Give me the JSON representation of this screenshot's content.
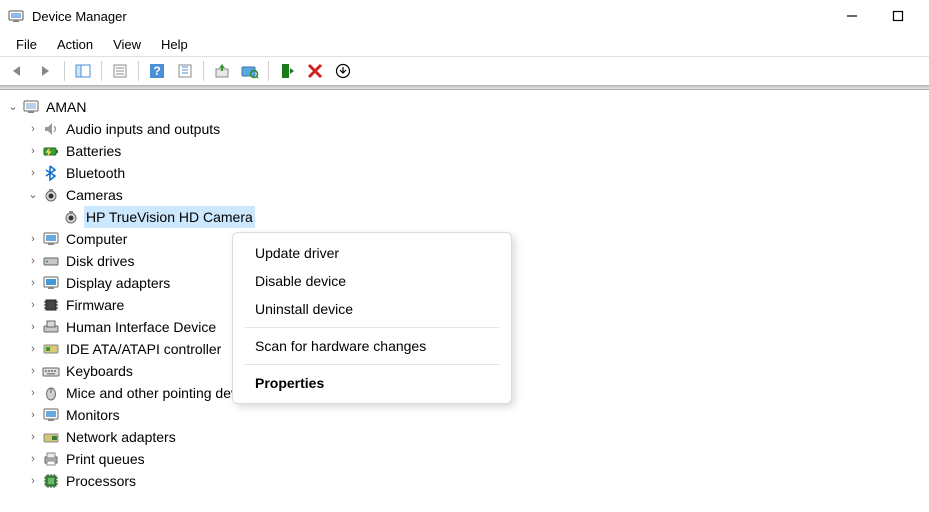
{
  "window": {
    "title": "Device Manager"
  },
  "menu": {
    "file": "File",
    "action": "Action",
    "view": "View",
    "help": "Help"
  },
  "tree": {
    "root": "AMAN",
    "audio": "Audio inputs and outputs",
    "batteries": "Batteries",
    "bluetooth": "Bluetooth",
    "cameras": "Cameras",
    "camera_device": "HP TrueVision HD Camera",
    "computer": "Computer",
    "disk": "Disk drives",
    "display": "Display adapters",
    "firmware": "Firmware",
    "hid": "Human Interface Device",
    "ide": "IDE ATA/ATAPI controller",
    "keyboards": "Keyboards",
    "mice": "Mice and other pointing devices",
    "monitors": "Monitors",
    "network": "Network adapters",
    "print": "Print queues",
    "processors": "Processors"
  },
  "context_menu": {
    "update": "Update driver",
    "disable": "Disable device",
    "uninstall": "Uninstall device",
    "scan": "Scan for hardware changes",
    "properties": "Properties"
  }
}
